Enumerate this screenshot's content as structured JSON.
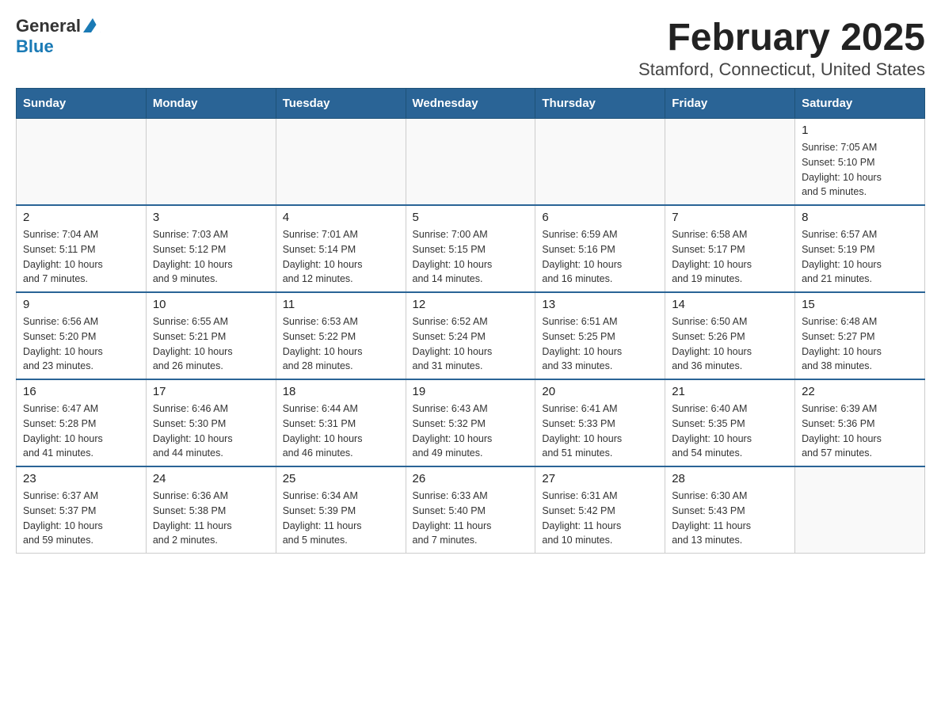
{
  "header": {
    "logo": {
      "text_general": "General",
      "text_blue": "Blue"
    },
    "title": "February 2025",
    "subtitle": "Stamford, Connecticut, United States"
  },
  "weekdays": [
    "Sunday",
    "Monday",
    "Tuesday",
    "Wednesday",
    "Thursday",
    "Friday",
    "Saturday"
  ],
  "weeks": [
    [
      {
        "day": "",
        "info": ""
      },
      {
        "day": "",
        "info": ""
      },
      {
        "day": "",
        "info": ""
      },
      {
        "day": "",
        "info": ""
      },
      {
        "day": "",
        "info": ""
      },
      {
        "day": "",
        "info": ""
      },
      {
        "day": "1",
        "info": "Sunrise: 7:05 AM\nSunset: 5:10 PM\nDaylight: 10 hours\nand 5 minutes."
      }
    ],
    [
      {
        "day": "2",
        "info": "Sunrise: 7:04 AM\nSunset: 5:11 PM\nDaylight: 10 hours\nand 7 minutes."
      },
      {
        "day": "3",
        "info": "Sunrise: 7:03 AM\nSunset: 5:12 PM\nDaylight: 10 hours\nand 9 minutes."
      },
      {
        "day": "4",
        "info": "Sunrise: 7:01 AM\nSunset: 5:14 PM\nDaylight: 10 hours\nand 12 minutes."
      },
      {
        "day": "5",
        "info": "Sunrise: 7:00 AM\nSunset: 5:15 PM\nDaylight: 10 hours\nand 14 minutes."
      },
      {
        "day": "6",
        "info": "Sunrise: 6:59 AM\nSunset: 5:16 PM\nDaylight: 10 hours\nand 16 minutes."
      },
      {
        "day": "7",
        "info": "Sunrise: 6:58 AM\nSunset: 5:17 PM\nDaylight: 10 hours\nand 19 minutes."
      },
      {
        "day": "8",
        "info": "Sunrise: 6:57 AM\nSunset: 5:19 PM\nDaylight: 10 hours\nand 21 minutes."
      }
    ],
    [
      {
        "day": "9",
        "info": "Sunrise: 6:56 AM\nSunset: 5:20 PM\nDaylight: 10 hours\nand 23 minutes."
      },
      {
        "day": "10",
        "info": "Sunrise: 6:55 AM\nSunset: 5:21 PM\nDaylight: 10 hours\nand 26 minutes."
      },
      {
        "day": "11",
        "info": "Sunrise: 6:53 AM\nSunset: 5:22 PM\nDaylight: 10 hours\nand 28 minutes."
      },
      {
        "day": "12",
        "info": "Sunrise: 6:52 AM\nSunset: 5:24 PM\nDaylight: 10 hours\nand 31 minutes."
      },
      {
        "day": "13",
        "info": "Sunrise: 6:51 AM\nSunset: 5:25 PM\nDaylight: 10 hours\nand 33 minutes."
      },
      {
        "day": "14",
        "info": "Sunrise: 6:50 AM\nSunset: 5:26 PM\nDaylight: 10 hours\nand 36 minutes."
      },
      {
        "day": "15",
        "info": "Sunrise: 6:48 AM\nSunset: 5:27 PM\nDaylight: 10 hours\nand 38 minutes."
      }
    ],
    [
      {
        "day": "16",
        "info": "Sunrise: 6:47 AM\nSunset: 5:28 PM\nDaylight: 10 hours\nand 41 minutes."
      },
      {
        "day": "17",
        "info": "Sunrise: 6:46 AM\nSunset: 5:30 PM\nDaylight: 10 hours\nand 44 minutes."
      },
      {
        "day": "18",
        "info": "Sunrise: 6:44 AM\nSunset: 5:31 PM\nDaylight: 10 hours\nand 46 minutes."
      },
      {
        "day": "19",
        "info": "Sunrise: 6:43 AM\nSunset: 5:32 PM\nDaylight: 10 hours\nand 49 minutes."
      },
      {
        "day": "20",
        "info": "Sunrise: 6:41 AM\nSunset: 5:33 PM\nDaylight: 10 hours\nand 51 minutes."
      },
      {
        "day": "21",
        "info": "Sunrise: 6:40 AM\nSunset: 5:35 PM\nDaylight: 10 hours\nand 54 minutes."
      },
      {
        "day": "22",
        "info": "Sunrise: 6:39 AM\nSunset: 5:36 PM\nDaylight: 10 hours\nand 57 minutes."
      }
    ],
    [
      {
        "day": "23",
        "info": "Sunrise: 6:37 AM\nSunset: 5:37 PM\nDaylight: 10 hours\nand 59 minutes."
      },
      {
        "day": "24",
        "info": "Sunrise: 6:36 AM\nSunset: 5:38 PM\nDaylight: 11 hours\nand 2 minutes."
      },
      {
        "day": "25",
        "info": "Sunrise: 6:34 AM\nSunset: 5:39 PM\nDaylight: 11 hours\nand 5 minutes."
      },
      {
        "day": "26",
        "info": "Sunrise: 6:33 AM\nSunset: 5:40 PM\nDaylight: 11 hours\nand 7 minutes."
      },
      {
        "day": "27",
        "info": "Sunrise: 6:31 AM\nSunset: 5:42 PM\nDaylight: 11 hours\nand 10 minutes."
      },
      {
        "day": "28",
        "info": "Sunrise: 6:30 AM\nSunset: 5:43 PM\nDaylight: 11 hours\nand 13 minutes."
      },
      {
        "day": "",
        "info": ""
      }
    ]
  ]
}
